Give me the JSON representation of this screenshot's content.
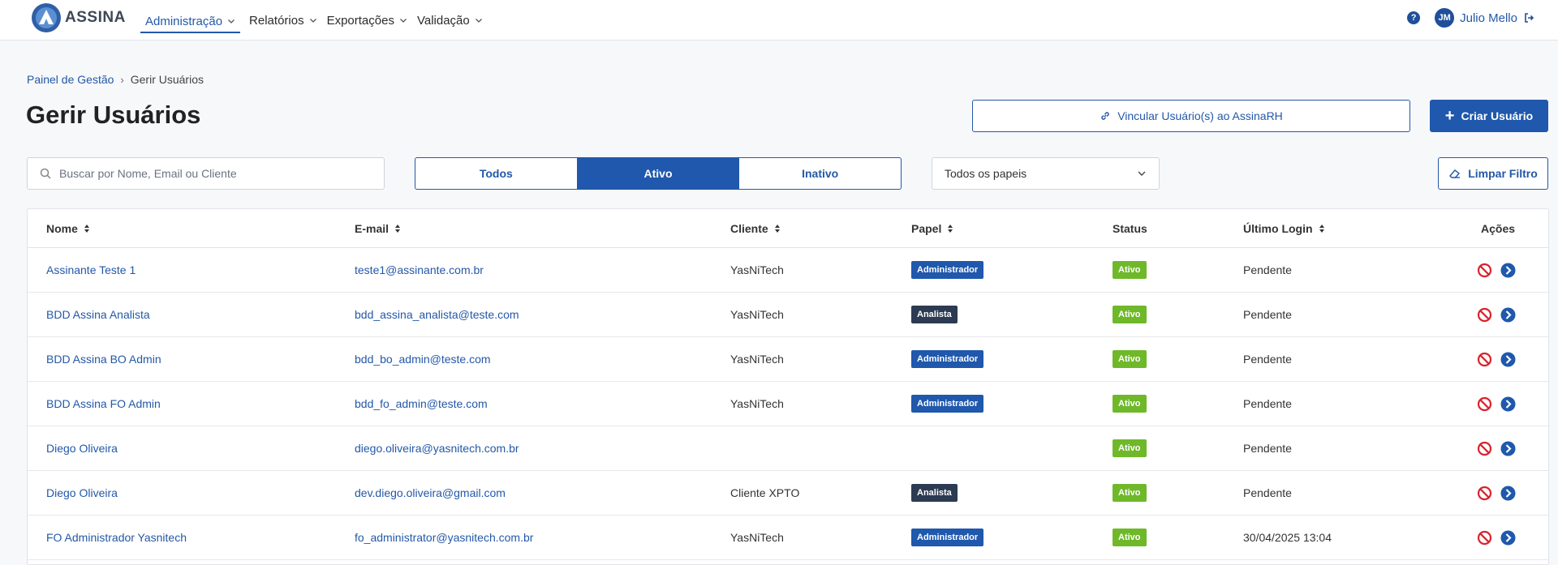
{
  "app": {
    "brand": "ASSINA",
    "nav": [
      {
        "label": "Administração",
        "active": true
      },
      {
        "label": "Relatórios",
        "active": false
      },
      {
        "label": "Exportações",
        "active": false
      },
      {
        "label": "Validação",
        "active": false
      }
    ],
    "user": {
      "initials": "JM",
      "name": "Julio Mello"
    },
    "help": "?"
  },
  "breadcrumb": {
    "parent": "Painel de Gestão",
    "separator": "›",
    "current": "Gerir Usuários"
  },
  "page": {
    "title": "Gerir Usuários",
    "link_button": "Vincular Usuário(s) ao AssinaRH",
    "create_button": "Criar Usuário",
    "create_plus": "+"
  },
  "filters": {
    "search_placeholder": "Buscar por Nome, Email ou Cliente",
    "segments": [
      {
        "label": "Todos",
        "active": false
      },
      {
        "label": "Ativo",
        "active": true
      },
      {
        "label": "Inativo",
        "active": false
      }
    ],
    "role_select": "Todos os papeis",
    "clear_button": "Limpar Filtro"
  },
  "table": {
    "headers": {
      "name": "Nome",
      "email": "E-mail",
      "client": "Cliente",
      "role": "Papel",
      "status": "Status",
      "last_login": "Último Login",
      "actions": "Ações"
    },
    "rows": [
      {
        "name": "Assinante Teste 1",
        "email": "teste1@assinante.com.br",
        "client": "YasNiTech",
        "role": "Administrador",
        "status": "Ativo",
        "last_login": "Pendente"
      },
      {
        "name": "BDD Assina Analista",
        "email": "bdd_assina_analista@teste.com",
        "client": "YasNiTech",
        "role": "Analista",
        "status": "Ativo",
        "last_login": "Pendente"
      },
      {
        "name": "BDD Assina BO Admin",
        "email": "bdd_bo_admin@teste.com",
        "client": "YasNiTech",
        "role": "Administrador",
        "status": "Ativo",
        "last_login": "Pendente"
      },
      {
        "name": "BDD Assina FO Admin",
        "email": "bdd_fo_admin@teste.com",
        "client": "YasNiTech",
        "role": "Administrador",
        "status": "Ativo",
        "last_login": "Pendente"
      },
      {
        "name": "Diego Oliveira",
        "email": "diego.oliveira@yasnitech.com.br",
        "client": "",
        "role": "",
        "status": "Ativo",
        "last_login": "Pendente"
      },
      {
        "name": "Diego Oliveira",
        "email": "dev.diego.oliveira@gmail.com",
        "client": "Cliente XPTO",
        "role": "Analista",
        "status": "Ativo",
        "last_login": "Pendente"
      },
      {
        "name": "FO Administrador Yasnitech",
        "email": "fo_administrator@yasnitech.com.br",
        "client": "YasNiTech",
        "role": "Administrador",
        "status": "Ativo",
        "last_login": "30/04/2025 13:04"
      }
    ]
  },
  "colors": {
    "primary": "#1f58ac",
    "active_badge": "#6fb82a",
    "analyst_badge": "#2c3a52",
    "danger": "#d9232e"
  }
}
